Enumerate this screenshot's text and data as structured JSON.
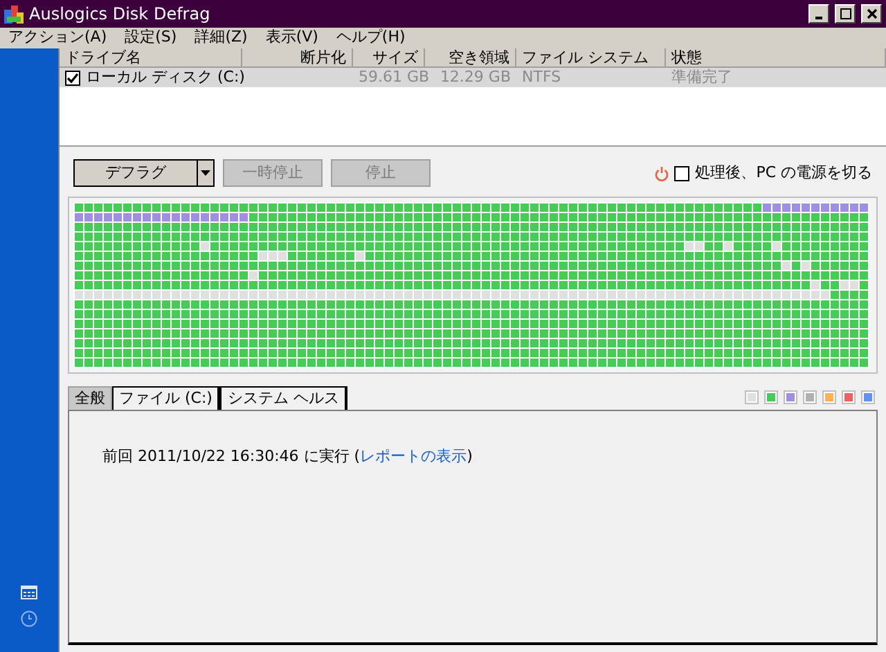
{
  "window": {
    "title": "Auslogics Disk Defrag"
  },
  "menu": [
    "アクション(A)",
    "設定(S)",
    "詳細(Z)",
    "表示(V)",
    "ヘルプ(H)"
  ],
  "table": {
    "columns": [
      "ドライブ名",
      "断片化",
      "サイズ",
      "空き領域",
      "ファイル システム",
      "状態"
    ],
    "rows": [
      {
        "checked": true,
        "selected": true,
        "cells": [
          "ローカル ディスク (C:)",
          "",
          "59.61 GB",
          "12.29 GB",
          "NTFS",
          "準備完了"
        ]
      }
    ]
  },
  "buttons": [
    {
      "label": "デフラグ",
      "disabled": false,
      "dropdown": true
    },
    {
      "label": "一時停止",
      "disabled": true,
      "dropdown": false
    },
    {
      "label": "停止",
      "disabled": true,
      "dropdown": false
    }
  ],
  "shutdown": {
    "label": "処理後、PC の電源を切る",
    "checked": false
  },
  "tabs": [
    {
      "label": "全般",
      "selected": true
    },
    {
      "label": "ファイル (C:)",
      "selected": false
    },
    {
      "label": "システム ヘルス",
      "selected": false
    }
  ],
  "legend": [
    {
      "color": "#e0e0e0"
    },
    {
      "color": "#44cc55"
    },
    {
      "color": "#a08ee0"
    },
    {
      "color": "#b0b0b0"
    },
    {
      "color": "#ffb050"
    },
    {
      "color": "#f06060"
    },
    {
      "color": "#6090f0"
    }
  ],
  "last_run": {
    "prefix": "前回",
    "time": "2011/10/22 16:30:46",
    "suffix": "に実行 (",
    "link": "レポートの表示",
    "close": ")"
  }
}
